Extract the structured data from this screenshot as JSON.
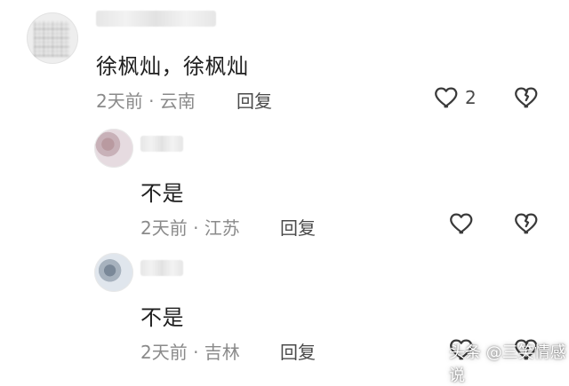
{
  "comments": [
    {
      "text": "徐枫灿，徐枫灿",
      "meta": "2天前 · 云南",
      "reply_label": "回复",
      "like_count": "2",
      "icons": [
        "heart-outline-icon",
        "broken-heart-icon"
      ]
    },
    {
      "text": "不是",
      "meta": "2天前 · 江苏",
      "reply_label": "回复",
      "icons": [
        "heart-outline-icon",
        "broken-heart-icon"
      ]
    },
    {
      "text": "不是",
      "meta": "2天前 · 吉林",
      "reply_label": "回复",
      "icons": [
        "heart-outline-icon",
        "broken-heart-icon"
      ]
    }
  ],
  "watermark": "头条 @三笑情感说"
}
